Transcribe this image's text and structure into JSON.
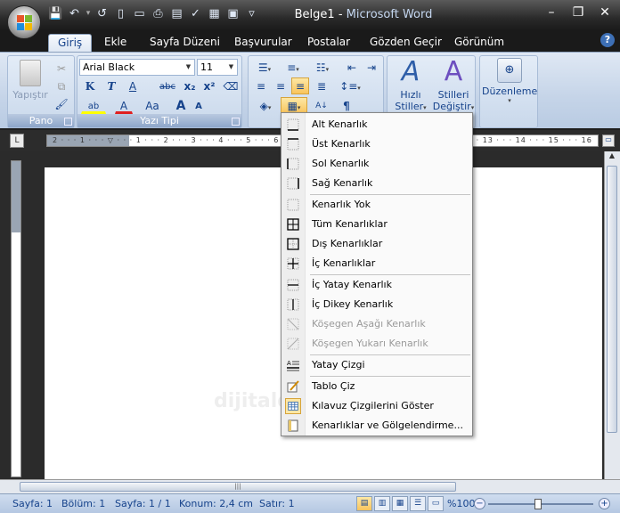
{
  "window": {
    "doc_name": "Belge1",
    "separator": " - ",
    "app_name": "Microsoft Word",
    "minimize": "–",
    "restore": "❐",
    "close": "✕"
  },
  "quick_access": [
    "save-icon",
    "undo-icon",
    "redo-icon",
    "new-icon",
    "open-icon",
    "print-preview-icon",
    "quick-print-icon",
    "spelling-icon",
    "research-icon",
    "customize-icon"
  ],
  "tabs": [
    {
      "label": "Giriş",
      "active": true
    },
    {
      "label": "Ekle"
    },
    {
      "label": "Sayfa Düzeni"
    },
    {
      "label": "Başvurular"
    },
    {
      "label": "Postalar"
    },
    {
      "label": "Gözden Geçir"
    },
    {
      "label": "Görünüm"
    }
  ],
  "help_label": "?",
  "ribbon": {
    "clipboard": {
      "group_label": "Pano",
      "paste_label": "Yapıştır"
    },
    "font": {
      "group_label": "Yazı Tipi",
      "font_name": "Arial Black",
      "font_size": "11",
      "bold": "K",
      "italic": "T",
      "underline": "A",
      "strike": "abc",
      "subscript": "x₂",
      "superscript": "x²",
      "grow": "A",
      "shrink": "A",
      "change_case": "Aa",
      "font_color": "A",
      "highlight": "ab"
    },
    "paragraph": {
      "pilcrow": "¶",
      "sort": "A↓"
    },
    "styles": {
      "quick_styles_line1": "Hızlı",
      "quick_styles_line2": "Stiller",
      "change_styles_line1": "Stilleri",
      "change_styles_line2": "Değiştir"
    },
    "editing": {
      "label": "Düzenleme"
    }
  },
  "ruler": {
    "ticks": "2 · · · 1 · · · ▽ · · · 1 · · · 2 · · · 3 · · · 4 · · · 5 · · · 6 · · · 7 · · · 8 · · · 9 · · · 10 · · · 11 · · · 12 · · · 13 · · · 14 · · · 15 · · · 16"
  },
  "border_menu": {
    "items": [
      {
        "label": "Alt Kenarlık",
        "icon": "bottom-border-icon",
        "disabled": false
      },
      {
        "label": "Üst Kenarlık",
        "icon": "top-border-icon",
        "disabled": false
      },
      {
        "label": "Sol Kenarlık",
        "icon": "left-border-icon",
        "disabled": false
      },
      {
        "label": "Sağ Kenarlık",
        "icon": "right-border-icon",
        "disabled": false
      },
      {
        "label": "Kenarlık Yok",
        "icon": "no-border-icon",
        "disabled": false
      },
      {
        "label": "Tüm Kenarlıklar",
        "icon": "all-borders-icon",
        "disabled": false
      },
      {
        "label": "Dış Kenarlıklar",
        "icon": "outside-borders-icon",
        "disabled": false
      },
      {
        "label": "İç Kenarlıklar",
        "icon": "inside-borders-icon",
        "disabled": false
      },
      {
        "label": "İç Yatay Kenarlık",
        "icon": "inside-horizontal-border-icon",
        "disabled": false
      },
      {
        "label": "İç Dikey Kenarlık",
        "icon": "inside-vertical-border-icon",
        "disabled": false
      },
      {
        "label": "Köşegen Aşağı Kenarlık",
        "icon": "diagonal-down-border-icon",
        "disabled": true
      },
      {
        "label": "Köşegen Yukarı Kenarlık",
        "icon": "diagonal-up-border-icon",
        "disabled": true
      },
      {
        "label": "Yatay Çizgi",
        "icon": "horizontal-line-icon",
        "disabled": false
      },
      {
        "label": "Tablo Çiz",
        "icon": "draw-table-icon",
        "disabled": false
      },
      {
        "label": "Kılavuz Çizgilerini Göster",
        "icon": "view-gridlines-icon",
        "disabled": false,
        "active": true
      },
      {
        "label": "Kenarlıklar ve Gölgelendirme...",
        "icon": "borders-shading-icon",
        "disabled": false
      }
    ]
  },
  "status": {
    "page": "Sayfa: 1",
    "section": "Bölüm: 1",
    "page_of": "Sayfa: 1 / 1",
    "position": "Konum: 2,4 cm",
    "line": "Satır: 1",
    "zoom": "%100"
  },
  "watermark": "dijitalders"
}
